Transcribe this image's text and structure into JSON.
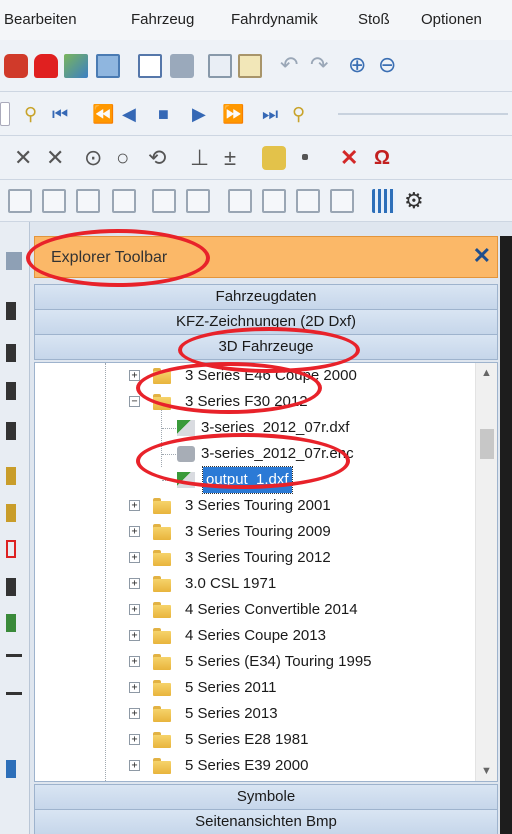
{
  "menu": {
    "items": [
      "Bearbeiten",
      "Fahrzeug",
      "Fahrdynamik",
      "Stoß",
      "Optionen"
    ]
  },
  "toolbar_icons": {
    "row1": [
      "open-car-icon",
      "red-car-icon",
      "chart-edit-icon",
      "image-icon",
      "print-preview-icon",
      "print-icon",
      "copy-icon",
      "paste-icon",
      "undo-icon",
      "redo-icon",
      "zoom-in-icon",
      "zoom-out-icon"
    ],
    "row2": [
      "first-key-icon",
      "skip-start-icon",
      "rewind-icon",
      "step-back-icon",
      "stop-icon",
      "play-icon",
      "fast-forward-icon",
      "skip-end-icon",
      "last-key-icon"
    ],
    "row3": [
      "cross-icon",
      "cross-icon",
      "circle-icon",
      "circle-icon",
      "rotate-circle-icon",
      "perpendicular-icon",
      "plus-minus-icon",
      "measure-icon",
      "point-icon",
      "red-cross-icon",
      "magnet-icon"
    ],
    "row4": [
      "layer-icon",
      "layer-icon",
      "layer-icon",
      "layer-icon",
      "layer-icon",
      "layer-icon",
      "grid-plus-icon",
      "square-icon",
      "square-icon",
      "move-icon",
      "grid-icon",
      "gear-icon"
    ]
  },
  "explorer": {
    "title": "Explorer Toolbar",
    "close": "✕",
    "sections_top": [
      "Fahrzeugdaten",
      "KFZ-Zeichnungen (2D Dxf)",
      "3D Fahrzeuge"
    ],
    "sections_bottom": [
      "Symbole",
      "Seitenansichten Bmp"
    ]
  },
  "tree": {
    "items": [
      {
        "label": "3 Series E46 Coupe 2000",
        "expanded": false
      },
      {
        "label": "3 Series F30 2012",
        "expanded": true
      },
      {
        "label": "3-series_2012_07r.dxf",
        "kind": "dxf"
      },
      {
        "label": "3-series_2012_07r.enc",
        "kind": "enc"
      },
      {
        "label": "output_1.dxf",
        "kind": "dxf",
        "selected": true
      },
      {
        "label": "3 Series Touring 2001",
        "expanded": false
      },
      {
        "label": "3 Series Touring 2009",
        "expanded": false
      },
      {
        "label": "3 Series Touring 2012",
        "expanded": false
      },
      {
        "label": "3.0 CSL 1971",
        "expanded": false
      },
      {
        "label": "4 Series Convertible 2014",
        "expanded": false
      },
      {
        "label": "4 Series Coupe 2013",
        "expanded": false
      },
      {
        "label": "5 Series (E34) Touring 1995",
        "expanded": false
      },
      {
        "label": "5 Series 2011",
        "expanded": false
      },
      {
        "label": "5 Series 2013",
        "expanded": false
      },
      {
        "label": "5 Series E28 1981",
        "expanded": false
      },
      {
        "label": "5 Series E39 2000",
        "expanded": false
      }
    ],
    "expand_glyph": "+",
    "collapse_glyph": "−"
  },
  "colors": {
    "header_orange": "#fbb868",
    "annotation_red": "#e8222a",
    "selection_blue": "#2b7ad6"
  }
}
